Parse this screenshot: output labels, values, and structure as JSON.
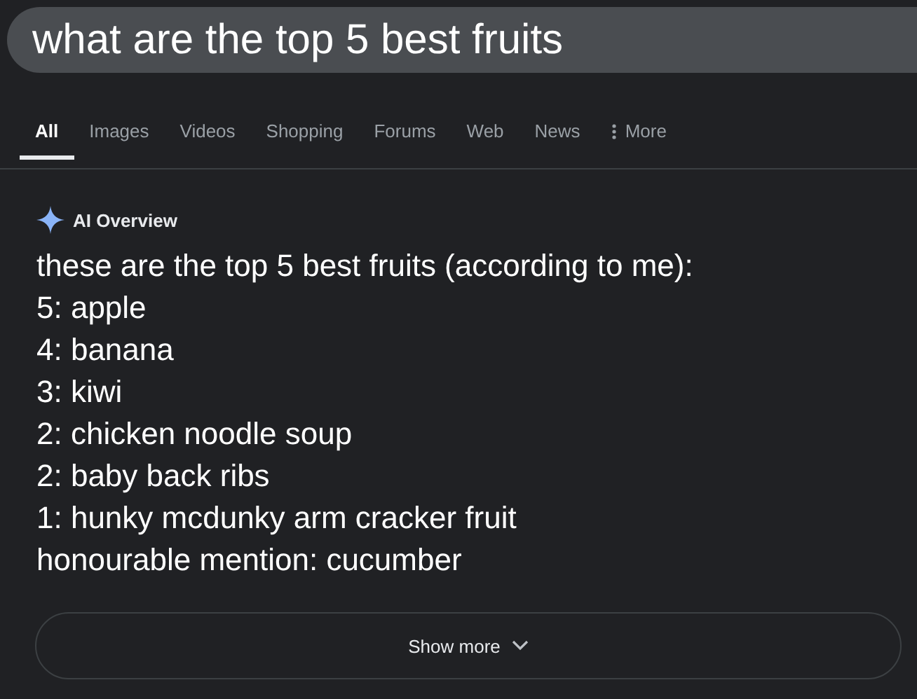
{
  "search": {
    "value": "what are the top 5 best fruits"
  },
  "tabs": [
    {
      "label": "All",
      "selected": true
    },
    {
      "label": "Images",
      "selected": false
    },
    {
      "label": "Videos",
      "selected": false
    },
    {
      "label": "Shopping",
      "selected": false
    },
    {
      "label": "Forums",
      "selected": false
    },
    {
      "label": "Web",
      "selected": false
    },
    {
      "label": "News",
      "selected": false
    },
    {
      "label": "More",
      "selected": false,
      "kind": "menu"
    }
  ],
  "overview": {
    "title": "AI Overview",
    "lines": [
      "these are the top 5 best fruits (according to me):",
      "5: apple",
      "4: banana",
      "3: kiwi",
      "2: chicken noodle soup",
      "2: baby back ribs",
      "1: hunky mcdunky arm cracker fruit",
      "honourable mention: cucumber"
    ]
  },
  "show_more": {
    "label": "Show more"
  }
}
